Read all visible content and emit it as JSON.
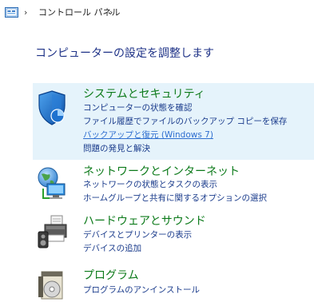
{
  "breadcrumb": {
    "path": "コントロール パネル"
  },
  "page": {
    "title": "コンピューターの設定を調整します"
  },
  "categories": [
    {
      "title": "システムとセキュリティ",
      "icon": "shield-icon",
      "links": [
        "コンピューターの状態を確認",
        "ファイル履歴でファイルのバックアップ コピーを保存",
        "バックアップと復元 (Windows 7)",
        "問題の発見と解決"
      ]
    },
    {
      "title": "ネットワークとインターネット",
      "icon": "network-globe-icon",
      "links": [
        "ネットワークの状態とタスクの表示",
        "ホームグループと共有に関するオプションの選択"
      ]
    },
    {
      "title": "ハードウェアとサウンド",
      "icon": "printer-speaker-icon",
      "links": [
        "デバイスとプリンターの表示",
        "デバイスの追加"
      ]
    },
    {
      "title": "プログラム",
      "icon": "programs-disc-icon",
      "links": [
        "プログラムのアンインストール"
      ]
    }
  ],
  "colors": {
    "category_title": "#0c7a1a",
    "link": "#1b3c8c",
    "link_hover": "#2f6fd0",
    "selected_background": "#e5f3fb",
    "page_title": "#1e3287"
  }
}
